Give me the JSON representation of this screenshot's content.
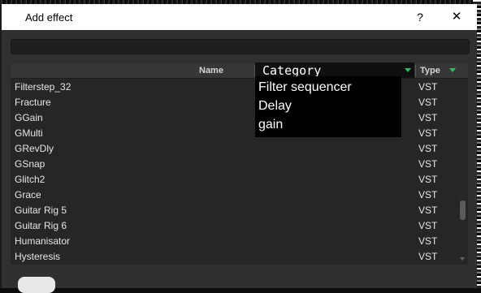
{
  "dialog": {
    "title": "Add effect",
    "help_label": "?",
    "close_label": "✕"
  },
  "table": {
    "columns": {
      "name": "Name",
      "category": "Category",
      "type": "Type"
    },
    "rows": [
      {
        "name": "Filterstep_32",
        "type": "VST"
      },
      {
        "name": "Fracture",
        "type": "VST"
      },
      {
        "name": "GGain",
        "type": "VST"
      },
      {
        "name": "GMulti",
        "type": "VST"
      },
      {
        "name": "GRevDly",
        "type": "VST"
      },
      {
        "name": "GSnap",
        "type": "VST"
      },
      {
        "name": "Glitch2",
        "type": "VST"
      },
      {
        "name": "Grace",
        "type": "VST"
      },
      {
        "name": "Guitar Rig 5",
        "type": "VST"
      },
      {
        "name": "Guitar Rig 6",
        "type": "VST"
      },
      {
        "name": "Humanisator",
        "type": "VST"
      },
      {
        "name": "Hysteresis",
        "type": "VST"
      }
    ],
    "categories_visible": [
      "Filter sequencer",
      "Delay",
      "gain"
    ]
  },
  "colors": {
    "sort_arrow": "#2fbf5f",
    "header_bg": "#363636",
    "list_bg": "#262626"
  }
}
